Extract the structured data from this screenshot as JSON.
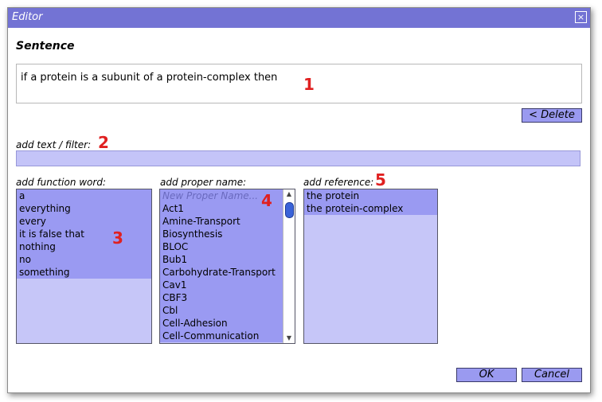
{
  "window": {
    "title": "Editor",
    "close_label": "×"
  },
  "sentence": {
    "heading": "Sentence",
    "text": "if a protein is a subunit of a protein-complex then"
  },
  "markers": {
    "m1": "1",
    "m2": "2",
    "m3": "3",
    "m4": "4",
    "m5": "5"
  },
  "buttons": {
    "delete": "< Delete",
    "ok": "OK",
    "cancel": "Cancel"
  },
  "filter": {
    "label": "add text / filter:",
    "value": ""
  },
  "function_words": {
    "label": "add function word:",
    "items": [
      "a",
      "everything",
      "every",
      "it is false that",
      "nothing",
      "no",
      "something"
    ]
  },
  "proper_names": {
    "label": "add proper name:",
    "placeholder": "New Proper Name...",
    "items": [
      "Act1",
      "Amine-Transport",
      "Biosynthesis",
      "BLOC",
      "Bub1",
      "Carbohydrate-Transport",
      "Cav1",
      "CBF3",
      "Cbl",
      "Cell-Adhesion",
      "Cell-Communication"
    ]
  },
  "references": {
    "label": "add reference:",
    "items": [
      "the protein",
      "the protein-complex"
    ]
  },
  "colors": {
    "titlebar": "#7373d4",
    "list_bg": "#c6c6f8",
    "list_items": "#9a9af2",
    "marker": "#e02020"
  },
  "icons": {
    "close": "close-icon",
    "scroll_up": "scroll-up-arrow-icon",
    "scroll_down": "scroll-down-arrow-icon"
  }
}
